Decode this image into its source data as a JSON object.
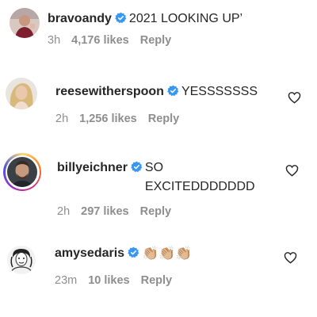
{
  "colors": {
    "verified_blue": "#3897f0",
    "meta_gray": "#8e8e8e",
    "text_dark": "#262626"
  },
  "comments": [
    {
      "username": "bravoandy",
      "verified": true,
      "text": "2021 LOOKING UP’",
      "time": "3h",
      "likes": "4,176 likes",
      "reply": "Reply",
      "avatar_icon": "person-photo-icon",
      "has_heart": false
    },
    {
      "username": "reesewitherspoon",
      "verified": true,
      "text": "YESSSSSSS",
      "time": "2h",
      "likes": "1,256 likes",
      "reply": "Reply",
      "avatar_icon": "person-photo-icon",
      "has_heart": true
    },
    {
      "username": "billyeichner",
      "verified": true,
      "text": "SO EXCITEDDDDDDD",
      "time": "2h",
      "likes": "297 likes",
      "reply": "Reply",
      "avatar_icon": "person-photo-icon",
      "has_heart": true,
      "has_story_ring": true
    },
    {
      "username": "amysedaris",
      "verified": true,
      "text": "👏🏼👏🏼👏🏼",
      "time": "23m",
      "likes": "10 likes",
      "reply": "Reply",
      "avatar_icon": "person-sketch-icon",
      "has_heart": true
    }
  ]
}
